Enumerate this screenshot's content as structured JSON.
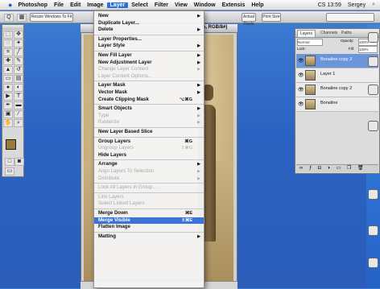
{
  "menubar": {
    "apple": "",
    "items": [
      "Photoshop",
      "File",
      "Edit",
      "Image",
      "Layer",
      "Select",
      "Filter",
      "View",
      "Window",
      "Extensis",
      "Help"
    ],
    "active_index": 4,
    "clock": "CS 13:59",
    "user": "Sergey"
  },
  "options": {
    "btn1": "Resize Windows To Fit",
    "btn2": "Actual Pixels",
    "btn3": "Print Size"
  },
  "document": {
    "title_tail": "%, RGB/8#)",
    "status": ""
  },
  "menu": {
    "items": [
      {
        "label": "New",
        "arrow": true
      },
      {
        "label": "Duplicate Layer..."
      },
      {
        "label": "Delete",
        "arrow": true
      },
      {
        "sep": true
      },
      {
        "label": "Layer Properties..."
      },
      {
        "label": "Layer Style",
        "arrow": true
      },
      {
        "sep": true
      },
      {
        "label": "New Fill Layer",
        "arrow": true
      },
      {
        "label": "New Adjustment Layer",
        "arrow": true
      },
      {
        "label": "Change Layer Content",
        "arrow": true,
        "disabled": true
      },
      {
        "label": "Layer Content Options...",
        "disabled": true
      },
      {
        "sep": true
      },
      {
        "label": "Layer Mask",
        "arrow": true
      },
      {
        "label": "Vector Mask",
        "arrow": true
      },
      {
        "label": "Create Clipping Mask",
        "shortcut": "⌥⌘G"
      },
      {
        "sep": true
      },
      {
        "label": "Smart Objects",
        "arrow": true
      },
      {
        "label": "Type",
        "arrow": true,
        "disabled": true
      },
      {
        "label": "Rasterize",
        "arrow": true,
        "disabled": true
      },
      {
        "sep": true
      },
      {
        "label": "New Layer Based Slice"
      },
      {
        "sep": true
      },
      {
        "label": "Group Layers",
        "shortcut": "⌘G"
      },
      {
        "label": "Ungroup Layers",
        "shortcut": "⇧⌘G",
        "disabled": true
      },
      {
        "label": "Hide Layers"
      },
      {
        "sep": true
      },
      {
        "label": "Arrange",
        "arrow": true
      },
      {
        "label": "Align Layers To Selection",
        "arrow": true,
        "disabled": true
      },
      {
        "label": "Distribute",
        "arrow": true,
        "disabled": true
      },
      {
        "sep": true
      },
      {
        "label": "Lock All Layers in Group...",
        "disabled": true
      },
      {
        "sep": true
      },
      {
        "label": "Link Layers",
        "disabled": true
      },
      {
        "label": "Select Linked Layers",
        "disabled": true
      },
      {
        "sep": true
      },
      {
        "label": "Merge Down",
        "shortcut": "⌘E"
      },
      {
        "label": "Merge Visible",
        "shortcut": "⇧⌘E",
        "highlighted": true
      },
      {
        "label": "Flatten Image"
      },
      {
        "sep": true
      },
      {
        "label": "Matting",
        "arrow": true
      }
    ]
  },
  "layers": {
    "tabs": [
      "Layers",
      "Channels",
      "Paths"
    ],
    "blend": "Normal",
    "opacity_label": "Opacity:",
    "opacity": "100%",
    "lock_label": "Lock:",
    "fill_label": "Fill:",
    "fill": "100%",
    "rows": [
      {
        "name": "Bonaline copy 3",
        "selected": true
      },
      {
        "name": "Layer 1",
        "selected": false
      },
      {
        "name": "Bonaline copy 2",
        "selected": false
      },
      {
        "name": "Bonaline",
        "selected": false
      }
    ]
  },
  "colors": {
    "menu_highlight": "#3a74d6",
    "desktop": "#2b63c2",
    "sepia": "#c9b283"
  }
}
